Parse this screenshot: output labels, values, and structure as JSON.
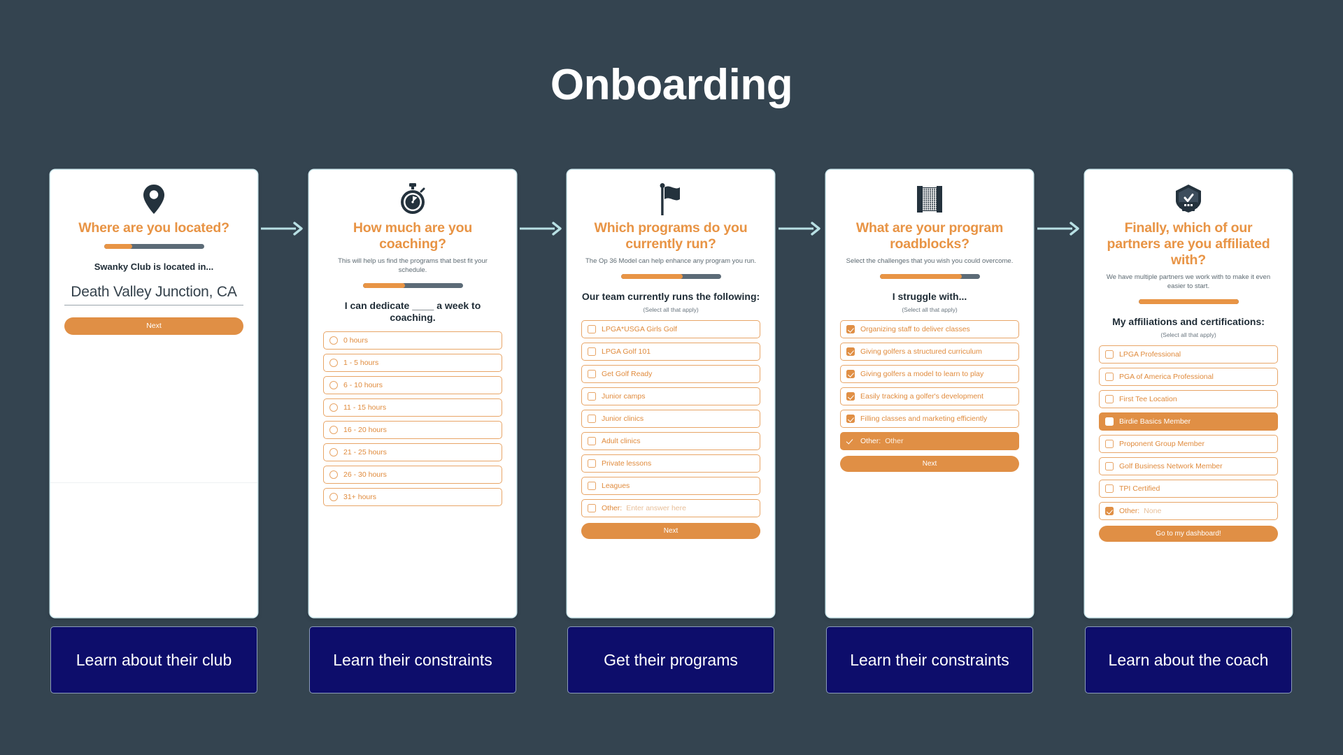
{
  "page": {
    "title": "Onboarding",
    "background_color": "#344450",
    "accent_color": "#e08f45",
    "arrow_color": "#b8e0e4",
    "label_box_color": "#0d0d6b"
  },
  "steps": [
    {
      "icon": "map-pin-icon",
      "title": "Where are you located?",
      "subtitle": "",
      "progress_percent": 28,
      "prompt": "Swanky Club is located in...",
      "prompt_note": "",
      "input_value": "Death Valley Junction, CA",
      "button_label": "Next",
      "options": [],
      "bottom_label": "Learn about their club"
    },
    {
      "icon": "stopwatch-icon",
      "title": "How much are you coaching?",
      "subtitle": "This will help us find the programs that best fit your schedule.",
      "progress_percent": 42,
      "prompt": "I can dedicate ____ a week to coaching.",
      "prompt_note": "",
      "input_value": "",
      "button_label": "",
      "options": [
        {
          "label": "0 hours",
          "control": "radio",
          "checked": false,
          "selected": false
        },
        {
          "label": "1 - 5 hours",
          "control": "radio",
          "checked": false,
          "selected": false
        },
        {
          "label": "6 - 10 hours",
          "control": "radio",
          "checked": false,
          "selected": false
        },
        {
          "label": "11 - 15 hours",
          "control": "radio",
          "checked": false,
          "selected": false
        },
        {
          "label": "16 - 20 hours",
          "control": "radio",
          "checked": false,
          "selected": false
        },
        {
          "label": "21 - 25 hours",
          "control": "radio",
          "checked": false,
          "selected": false
        },
        {
          "label": "26 - 30 hours",
          "control": "radio",
          "checked": false,
          "selected": false
        },
        {
          "label": "31+ hours",
          "control": "radio",
          "checked": false,
          "selected": false
        }
      ],
      "bottom_label": "Learn their constraints"
    },
    {
      "icon": "flag-icon",
      "title": "Which programs do you currently run?",
      "subtitle": "The Op 36 Model can help enhance any program you run.",
      "progress_percent": 62,
      "prompt": "Our team currently runs the following:",
      "prompt_note": "(Select all that apply)",
      "input_value": "",
      "button_label": "Next",
      "options": [
        {
          "label": "LPGA*USGA Girls Golf",
          "control": "checkbox",
          "checked": false,
          "selected": false
        },
        {
          "label": "LPGA Golf 101",
          "control": "checkbox",
          "checked": false,
          "selected": false
        },
        {
          "label": "Get Golf Ready",
          "control": "checkbox",
          "checked": false,
          "selected": false
        },
        {
          "label": "Junior camps",
          "control": "checkbox",
          "checked": false,
          "selected": false
        },
        {
          "label": "Junior clinics",
          "control": "checkbox",
          "checked": false,
          "selected": false
        },
        {
          "label": "Adult clinics",
          "control": "checkbox",
          "checked": false,
          "selected": false
        },
        {
          "label": "Private lessons",
          "control": "checkbox",
          "checked": false,
          "selected": false
        },
        {
          "label": "Leagues",
          "control": "checkbox",
          "checked": false,
          "selected": false
        },
        {
          "label": "Other:",
          "placeholder": "Enter answer here",
          "control": "checkbox",
          "checked": false,
          "selected": false
        }
      ],
      "bottom_label": "Get their programs"
    },
    {
      "icon": "net-icon",
      "title": "What are your program roadblocks?",
      "subtitle": "Select the challenges that you wish you could overcome.",
      "progress_percent": 82,
      "prompt": "I struggle with...",
      "prompt_note": "(Select all that apply)",
      "input_value": "",
      "button_label": "Next",
      "options": [
        {
          "label": "Organizing staff to deliver classes",
          "control": "checkbox",
          "checked": true,
          "selected": false
        },
        {
          "label": "Giving golfers a structured curriculum",
          "control": "checkbox",
          "checked": true,
          "selected": false
        },
        {
          "label": "Giving golfers a model to learn to play",
          "control": "checkbox",
          "checked": true,
          "selected": false
        },
        {
          "label": "Easily tracking a golfer's development",
          "control": "checkbox",
          "checked": true,
          "selected": false
        },
        {
          "label": "Filling classes and marketing efficiently",
          "control": "checkbox",
          "checked": true,
          "selected": false
        },
        {
          "label": "Other:",
          "placeholder": "Other",
          "control": "tick",
          "checked": true,
          "selected": true
        }
      ],
      "bottom_label": "Learn their constraints"
    },
    {
      "icon": "badge-icon",
      "title": "Finally, which of our partners are you affiliated with?",
      "subtitle": "We have multiple partners we work with to make it even easier to start.",
      "progress_percent": 100,
      "prompt": "My affiliations and certifications:",
      "prompt_note": "(Select all that apply)",
      "input_value": "",
      "button_label": "Go to my dashboard!",
      "options": [
        {
          "label": "LPGA Professional",
          "control": "checkbox",
          "checked": false,
          "selected": false
        },
        {
          "label": "PGA of America Professional",
          "control": "checkbox",
          "checked": false,
          "selected": false
        },
        {
          "label": "First Tee Location",
          "control": "checkbox",
          "checked": false,
          "selected": false
        },
        {
          "label": "Birdie Basics Member",
          "control": "checkbox",
          "checked": false,
          "selected": true
        },
        {
          "label": "Proponent Group Member",
          "control": "checkbox",
          "checked": false,
          "selected": false
        },
        {
          "label": "Golf Business Network Member",
          "control": "checkbox",
          "checked": false,
          "selected": false
        },
        {
          "label": "TPI Certified",
          "control": "checkbox",
          "checked": false,
          "selected": false
        },
        {
          "label": "Other:",
          "placeholder": "None",
          "control": "checkbox",
          "checked": true,
          "selected": false
        }
      ],
      "bottom_label": "Learn about the coach"
    }
  ]
}
